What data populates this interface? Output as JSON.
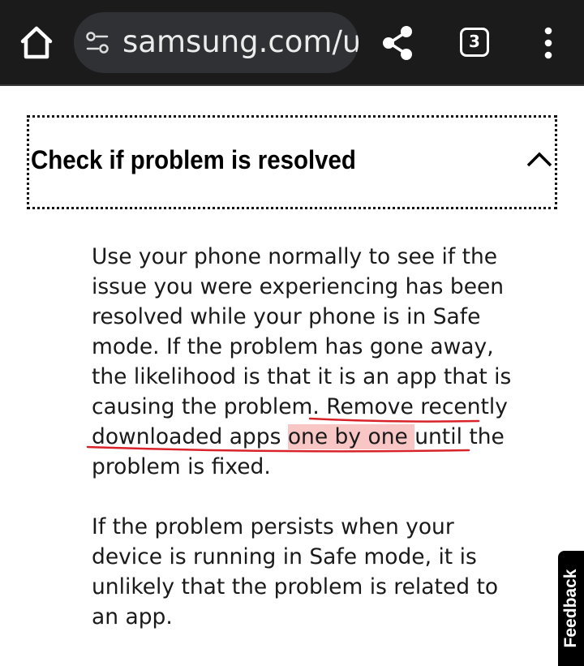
{
  "browser": {
    "url": "samsung.com/u",
    "tab_count": "3",
    "icons": {
      "home": "home-icon",
      "site_settings": "tune-icon",
      "share": "share-icon",
      "tabs": "tab-switcher-icon",
      "menu": "more-vert-icon"
    }
  },
  "accordion": {
    "title": "Check if problem is resolved",
    "expanded": true
  },
  "content": {
    "para1_lines": [
      "Use your phone normally to see if the",
      "issue you were experiencing has been",
      "resolved while your phone is in Safe",
      "mode. If the problem has gone away,",
      "the likelihood is that it is an app that is"
    ],
    "para1_line6_prefix": "causing the problem. ",
    "para1_line6_underlined": "Remove recently",
    "para1_line7_underlined_a": "downloaded apps ",
    "para1_line7_highlighted": "one by one ",
    "para1_line7_underlined_b": "until the",
    "para1_line8": "problem is fixed.",
    "para2_lines": [
      "If the problem persists when your",
      "device is running in Safe mode, it is",
      "unlikely that the problem is related to",
      "an app."
    ]
  },
  "feedback": {
    "label": "Feedback"
  },
  "colors": {
    "toolbar_bg": "#1b1b1b",
    "urlbar_bg": "#2f3134",
    "annotation_red": "#d8232a",
    "highlight": "#f07878"
  }
}
